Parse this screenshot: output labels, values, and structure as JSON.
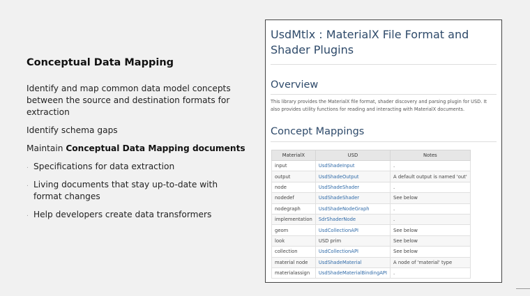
{
  "left": {
    "heading": "Conceptual Data Mapping",
    "paragraph1": "Identify and map common data model concepts between the source and destination formats for extraction",
    "paragraph2": "Identify schema gaps",
    "paragraph3_prefix": "Maintain ",
    "paragraph3_bold": "Conceptual Data Mapping documents",
    "bullets": [
      "Specifications for data extraction",
      "Living documents that stay up-to-date with format changes",
      "Help developers create data transformers"
    ],
    "bullet_marker": "."
  },
  "doc": {
    "title": "UsdMtlx : MaterialX File Format and Shader Plugins",
    "overview_heading": "Overview",
    "overview_text": "This library provides the MaterialX file format, shader discovery and parsing plugin for USD. It also provides utility functions for reading and interacting with MaterialX documents.",
    "concept_heading": "Concept Mappings",
    "table": {
      "headers": [
        "MaterialX",
        "USD",
        "Notes"
      ],
      "rows": [
        [
          "input",
          "UsdShadeInput",
          "."
        ],
        [
          "output",
          "UsdShadeOutput",
          "A default output is named 'out'"
        ],
        [
          "node",
          "UsdShadeShader",
          "."
        ],
        [
          "nodedef",
          "UsdShadeShader",
          "See below"
        ],
        [
          "nodegraph",
          "UsdShadeNodeGraph",
          "."
        ],
        [
          "implementation",
          "SdrShaderNode",
          "."
        ],
        [
          "geom",
          "UsdCollectionAPI",
          "See below"
        ],
        [
          "look",
          "USD prim",
          "See below"
        ],
        [
          "collection",
          "UsdCollectionAPI",
          "See below"
        ],
        [
          "material node",
          "UsdShadeMaterial",
          "A node of 'material' type"
        ],
        [
          "materialassign",
          "UsdShadeMaterialBindingAPI",
          "."
        ]
      ]
    }
  }
}
